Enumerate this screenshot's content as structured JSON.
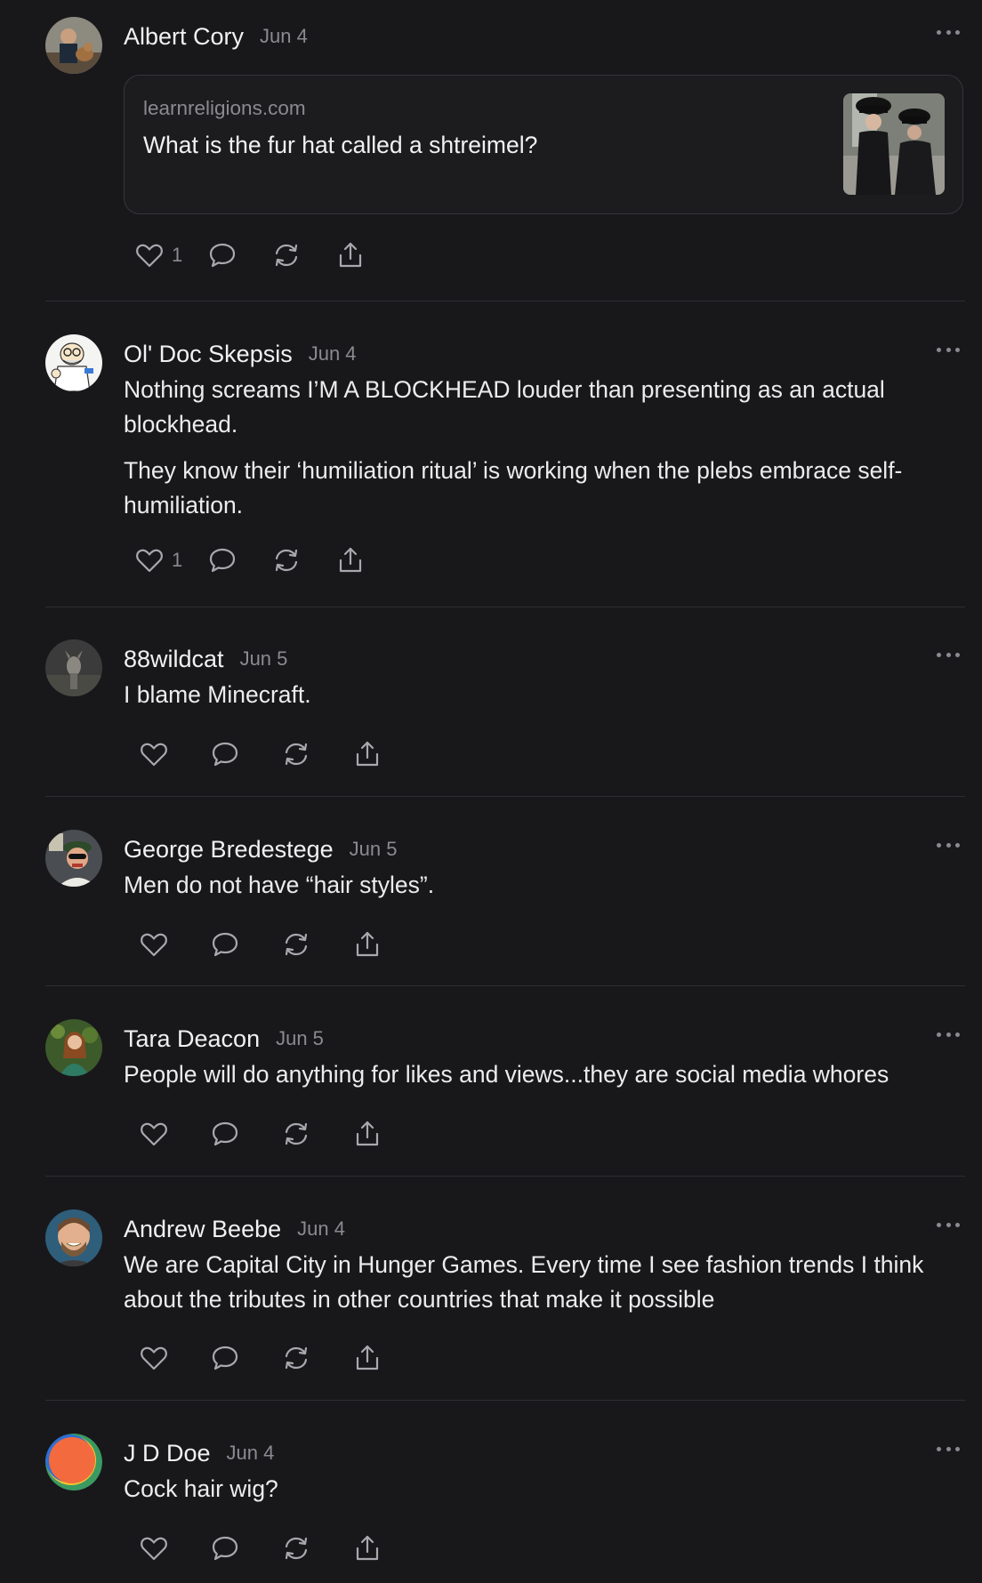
{
  "posts": [
    {
      "author": "Albert Cory",
      "date": "Jun 4",
      "link": {
        "domain": "learnreligions.com",
        "title": "What is the fur hat called a shtreimel?"
      },
      "paragraphs": [],
      "likes": "1"
    },
    {
      "author": "Ol' Doc Skepsis",
      "date": "Jun 4",
      "paragraphs": [
        "Nothing screams I’M A BLOCKHEAD louder than presenting as an actual blockhead.",
        "They know their ‘humiliation ritual’ is working when the plebs embrace self-humiliation."
      ],
      "likes": "1"
    },
    {
      "author": "88wildcat",
      "date": "Jun 5",
      "paragraphs": [
        "I blame Minecraft."
      ],
      "likes": ""
    },
    {
      "author": "George Bredestege",
      "date": "Jun 5",
      "paragraphs": [
        "Men do not have “hair styles”."
      ],
      "likes": ""
    },
    {
      "author": "Tara Deacon",
      "date": "Jun 5",
      "paragraphs": [
        "People will do anything for likes and views...they are social media whores"
      ],
      "likes": ""
    },
    {
      "author": "Andrew Beebe",
      "date": "Jun 4",
      "paragraphs": [
        "We are Capital City in Hunger Games. Every time I see fashion trends I think about the tributes in other countries that make it possible"
      ],
      "likes": ""
    },
    {
      "author": "J D Doe",
      "date": "Jun 4",
      "paragraphs": [
        "Cock hair wig?"
      ],
      "likes": ""
    }
  ],
  "icons": [
    "heart-icon",
    "comment-icon",
    "restack-icon",
    "share-icon",
    "more-icon"
  ],
  "colors": {
    "background": "#18181b",
    "text": "#ececed",
    "muted": "#8a8a90",
    "divider": "#2e2e32"
  }
}
